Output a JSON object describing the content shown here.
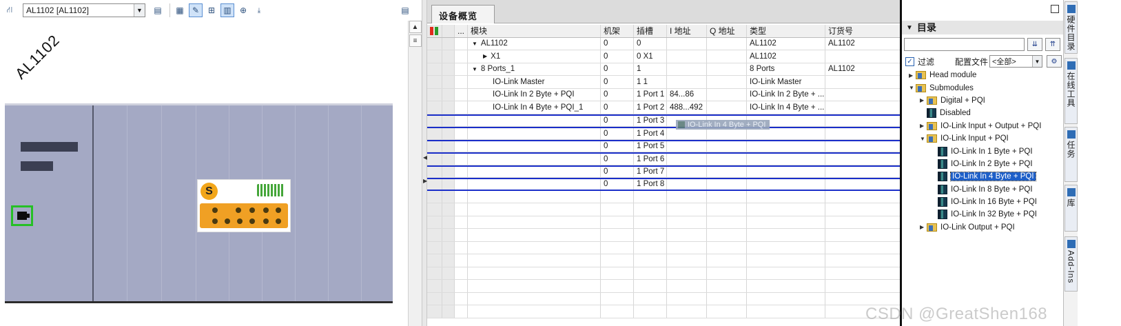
{
  "device_view": {
    "device_select": "AL1102 [AL1102]",
    "device_label": "AL1102"
  },
  "overview": {
    "tab_label": "设备概览",
    "headers": {
      "ind": "...",
      "module": "模块",
      "rack": "机架",
      "slot": "插槽",
      "iaddr": "I 地址",
      "qaddr": "Q 地址",
      "type": "类型",
      "order": "订货号"
    },
    "rows": [
      {
        "module": "AL1102",
        "rack": "0",
        "slot": "0",
        "iaddr": "",
        "qaddr": "",
        "type": "AL1102",
        "order": "AL1102",
        "tree": "down"
      },
      {
        "module": "X1",
        "rack": "0",
        "slot": "0 X1",
        "iaddr": "",
        "qaddr": "",
        "type": "AL1102",
        "order": "",
        "tree": "right"
      },
      {
        "module": "8 Ports_1",
        "rack": "0",
        "slot": "1",
        "iaddr": "",
        "qaddr": "",
        "type": "8 Ports",
        "order": "AL1102",
        "tree": "down"
      },
      {
        "module": "IO-Link Master",
        "rack": "0",
        "slot": "1 1",
        "iaddr": "",
        "qaddr": "",
        "type": "IO-Link Master",
        "order": "",
        "tree": ""
      },
      {
        "module": "IO-Link In  2 Byte + PQI",
        "rack": "0",
        "slot": "1 Port 1",
        "iaddr": "84...86",
        "qaddr": "",
        "type": "IO-Link In  2 Byte + ...",
        "order": "",
        "tree": ""
      },
      {
        "module": "IO-Link In  4 Byte + PQI_1",
        "rack": "0",
        "slot": "1 Port 2",
        "iaddr": "488...492",
        "qaddr": "",
        "type": "IO-Link In  4 Byte + ...",
        "order": "",
        "tree": ""
      },
      {
        "module": "",
        "rack": "0",
        "slot": "1 Port 3",
        "iaddr": "",
        "qaddr": "",
        "type": "",
        "order": "",
        "tree": ""
      },
      {
        "module": "",
        "rack": "0",
        "slot": "1 Port 4",
        "iaddr": "",
        "qaddr": "",
        "type": "",
        "order": "",
        "tree": ""
      },
      {
        "module": "",
        "rack": "0",
        "slot": "1 Port 5",
        "iaddr": "",
        "qaddr": "",
        "type": "",
        "order": "",
        "tree": ""
      },
      {
        "module": "",
        "rack": "0",
        "slot": "1 Port 6",
        "iaddr": "",
        "qaddr": "",
        "type": "",
        "order": "",
        "tree": ""
      },
      {
        "module": "",
        "rack": "0",
        "slot": "1 Port 7",
        "iaddr": "",
        "qaddr": "",
        "type": "",
        "order": "",
        "tree": ""
      },
      {
        "module": "",
        "rack": "0",
        "slot": "1 Port 8",
        "iaddr": "",
        "qaddr": "",
        "type": "",
        "order": "",
        "tree": ""
      }
    ],
    "drag_label": "IO-Link In  4 Byte + PQI"
  },
  "catalog": {
    "title": "目录",
    "filter_label": "过滤",
    "profile_label": "配置文件",
    "profile_value": "<全部>",
    "tree": [
      {
        "label": "Head module",
        "level": 0,
        "tri": "right",
        "icon": "folder"
      },
      {
        "label": "Submodules",
        "level": 0,
        "tri": "down",
        "icon": "folder"
      },
      {
        "label": "Digital + PQI",
        "level": 1,
        "tri": "right",
        "icon": "folder"
      },
      {
        "label": "Disabled",
        "level": 1,
        "tri": "",
        "icon": "module"
      },
      {
        "label": "IO-Link Input + Output + PQI",
        "level": 1,
        "tri": "right",
        "icon": "folder"
      },
      {
        "label": "IO-Link Input + PQI",
        "level": 1,
        "tri": "down",
        "icon": "folder"
      },
      {
        "label": "IO-Link In  1 Byte + PQI",
        "level": 2,
        "tri": "",
        "icon": "module"
      },
      {
        "label": "IO-Link In  2 Byte + PQI",
        "level": 2,
        "tri": "",
        "icon": "module"
      },
      {
        "label": "IO-Link In  4 Byte + PQI",
        "level": 2,
        "tri": "",
        "icon": "module",
        "selected": true
      },
      {
        "label": "IO-Link In  8 Byte + PQI",
        "level": 2,
        "tri": "",
        "icon": "module"
      },
      {
        "label": "IO-Link In 16 Byte + PQI",
        "level": 2,
        "tri": "",
        "icon": "module"
      },
      {
        "label": "IO-Link In 32 Byte + PQI",
        "level": 2,
        "tri": "",
        "icon": "module"
      },
      {
        "label": "IO-Link Output + PQI",
        "level": 1,
        "tri": "right",
        "icon": "folder"
      }
    ]
  },
  "side_tabs": [
    {
      "label": "硬件目录"
    },
    {
      "label": "在线工具"
    },
    {
      "label": "任务"
    },
    {
      "label": "库"
    },
    {
      "label": "Add-Ins"
    }
  ],
  "watermark": "CSDN @GreatShen168",
  "colors": {
    "rack": "#a4a9c4",
    "selection": "#1e5fc8",
    "row_divider_blue": "#1a2ec9",
    "port_highlight": "#25c025",
    "module_orange": "#f0a024"
  }
}
